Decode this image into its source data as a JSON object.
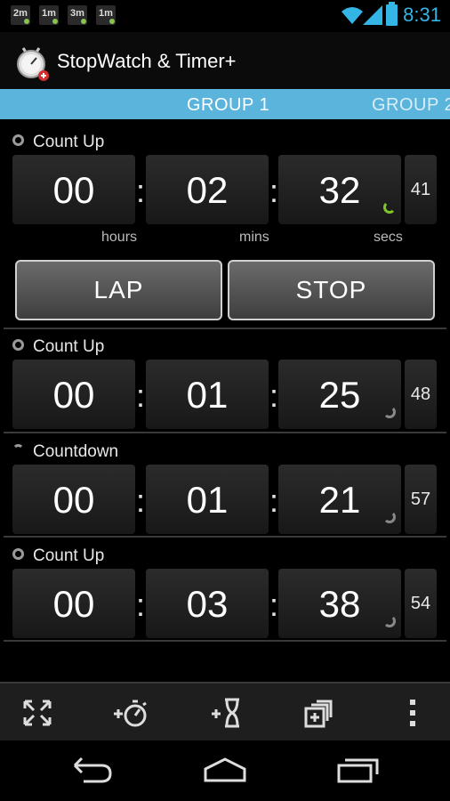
{
  "status_bar": {
    "notifications": [
      "2m",
      "1m",
      "3m",
      "1m"
    ],
    "time": "8:31"
  },
  "app": {
    "title": "StopWatch & Timer+",
    "icon": "stopwatch-app-icon"
  },
  "tabs": [
    {
      "label": "GROUP 1",
      "active": true
    },
    {
      "label": "GROUP 2",
      "active": false
    }
  ],
  "timers": [
    {
      "label": "Count Up",
      "hours": "00",
      "mins": "02",
      "secs": "32",
      "centis": "41",
      "expanded": true,
      "units": {
        "hours": "hours",
        "mins": "mins",
        "secs": "secs"
      },
      "buttons": {
        "lap": "LAP",
        "stop": "STOP"
      }
    },
    {
      "label": "Count Up",
      "hours": "00",
      "mins": "01",
      "secs": "25",
      "centis": "48"
    },
    {
      "label": "Countdown",
      "hours": "00",
      "mins": "01",
      "secs": "21",
      "centis": "57"
    },
    {
      "label": "Count Up",
      "hours": "00",
      "mins": "03",
      "secs": "38",
      "centis": "54"
    }
  ],
  "toolbar": [
    "fullscreen-icon",
    "add-stopwatch-icon",
    "add-timer-icon",
    "add-group-icon",
    "overflow-menu-icon"
  ],
  "nav": [
    "back-icon",
    "home-icon",
    "recents-icon"
  ],
  "colors": {
    "accent": "#33b5e5",
    "tab_bg": "#5ab4dc",
    "progress_active": "#7fc42a"
  }
}
